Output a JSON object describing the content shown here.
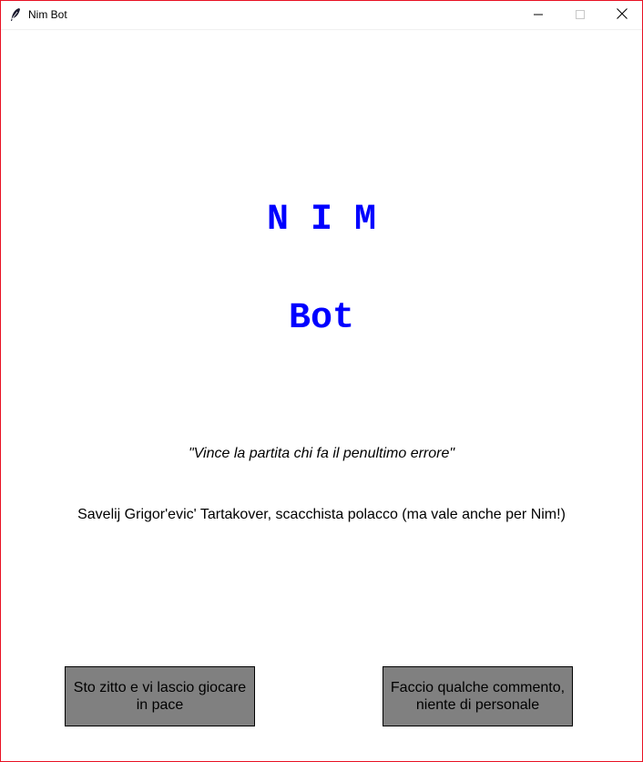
{
  "window": {
    "title": "Nim Bot"
  },
  "heading": {
    "nim": "N I M",
    "bot": "Bot",
    "color": "#0000ff"
  },
  "quote": "\"Vince la partita chi fa il penultimo errore\"",
  "attribution": "Savelij Grigor'evic' Tartakover, scacchista polacco (ma vale anche per Nim!)",
  "buttons": {
    "silent_label": "Sto zitto e vi lascio giocare in pace",
    "comment_label": "Faccio qualche commento, niente di personale",
    "background": "#808080"
  },
  "icons": {
    "app": "feather-icon",
    "minimize": "minimize-icon",
    "maximize": "maximize-icon",
    "close": "close-icon"
  }
}
